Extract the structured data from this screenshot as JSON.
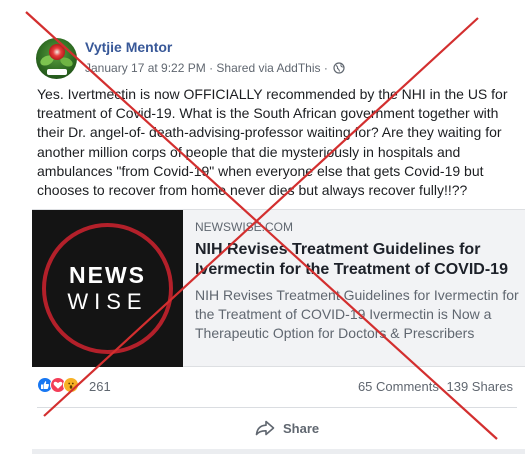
{
  "post": {
    "author": "Vytjie Mentor",
    "timestamp": "January 17 at 9:22 PM",
    "shared_via": "· Shared via AddThis ·",
    "privacy_icon": "globe-icon",
    "body": "Yes. Ivertmectin is now OFFICIALLY recommended by the NHI in the US for treatment of Covid-19. What is the South African government together with their Dr. angel-of- death-advising-professor waiting for? Are they waiting for another million corps of people that die mysteriously in hospitals and ambulances \"from Covid-19\" when everyone else that gets Covid-19 but chooses to recover from home never dies but always recover fully!!??"
  },
  "link_card": {
    "thumb_word1": "NEWS",
    "thumb_word2": "WISE",
    "domain": "NEWSWISE.COM",
    "headline": "NIH Revises Treatment Guidelines for Ivermectin for the Treatment of COVID-19",
    "description": "NIH Revises Treatment Guidelines for Ivermectin for the Treatment of COVID-19 Ivermectin is Now a Therapeutic Option for Doctors & Prescribers"
  },
  "engagement": {
    "reactions_count": "261",
    "comments": "65 Comments",
    "shares": "139 Shares"
  },
  "actions": {
    "share_label": "Share"
  },
  "colors": {
    "author_link": "#385898",
    "cross": "#d32f2f",
    "like": "#1877f2",
    "love": "#f33e58",
    "wow": "#f7b125"
  }
}
